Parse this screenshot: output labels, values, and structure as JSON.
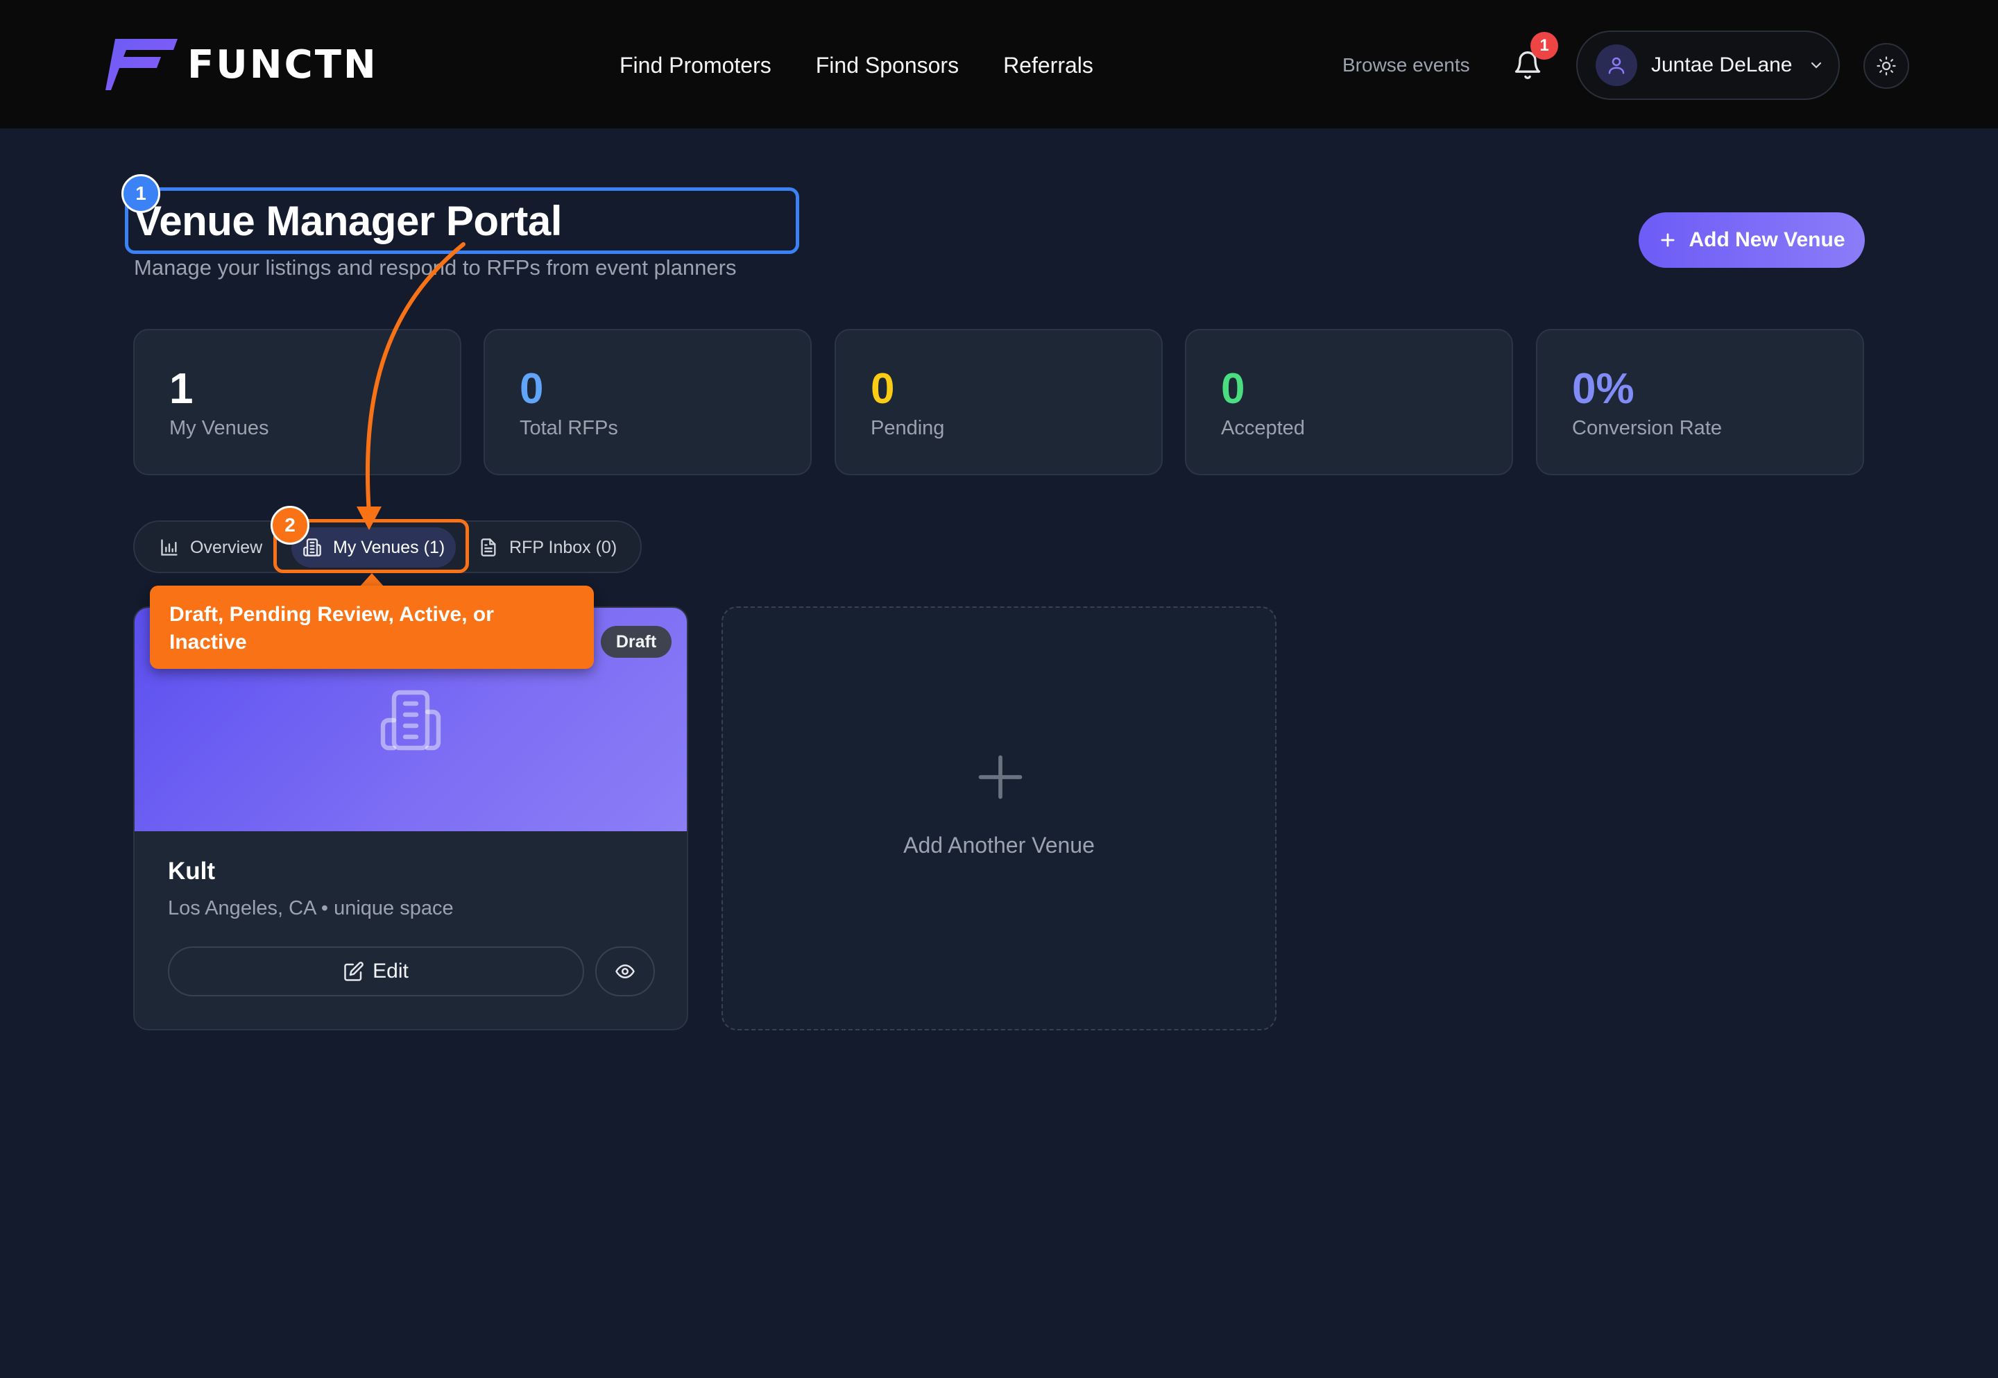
{
  "header": {
    "logo_text": "FUNCTN",
    "nav": [
      "Find Promoters",
      "Find Sponsors",
      "Referrals"
    ],
    "browse_events": "Browse events",
    "notification_count": "1",
    "user_name": "Juntae DeLane"
  },
  "page": {
    "title": "Venue Manager Portal",
    "subtitle": "Manage your listings and respond to RFPs from event planners",
    "add_button": "Add New Venue"
  },
  "stats": [
    {
      "value": "1",
      "label": "My Venues",
      "color": "#ffffff"
    },
    {
      "value": "0",
      "label": "Total RFPs",
      "color": "#60a5fa"
    },
    {
      "value": "0",
      "label": "Pending",
      "color": "#facc15"
    },
    {
      "value": "0",
      "label": "Accepted",
      "color": "#4ade80"
    },
    {
      "value": "0%",
      "label": "Conversion Rate",
      "color": "#818cf8"
    }
  ],
  "tabs": [
    {
      "label": "Overview",
      "icon": "bar-chart-icon"
    },
    {
      "label": "My Venues (1)",
      "icon": "building-icon",
      "active": true
    },
    {
      "label": "RFP Inbox (0)",
      "icon": "file-text-icon"
    }
  ],
  "venue": {
    "status": "Draft",
    "name": "Kult",
    "meta": "Los Angeles, CA • unique space",
    "edit_label": "Edit"
  },
  "add_card": {
    "label": "Add Another Venue"
  },
  "annotations": {
    "step1": "1",
    "step2": "2",
    "tooltip": "Draft, Pending Review, Active, or Inactive"
  },
  "colors": {
    "accent": "#6d5cf6",
    "highlight_blue": "#3b82f6",
    "highlight_orange": "#f97316",
    "background": "#131b2c"
  }
}
